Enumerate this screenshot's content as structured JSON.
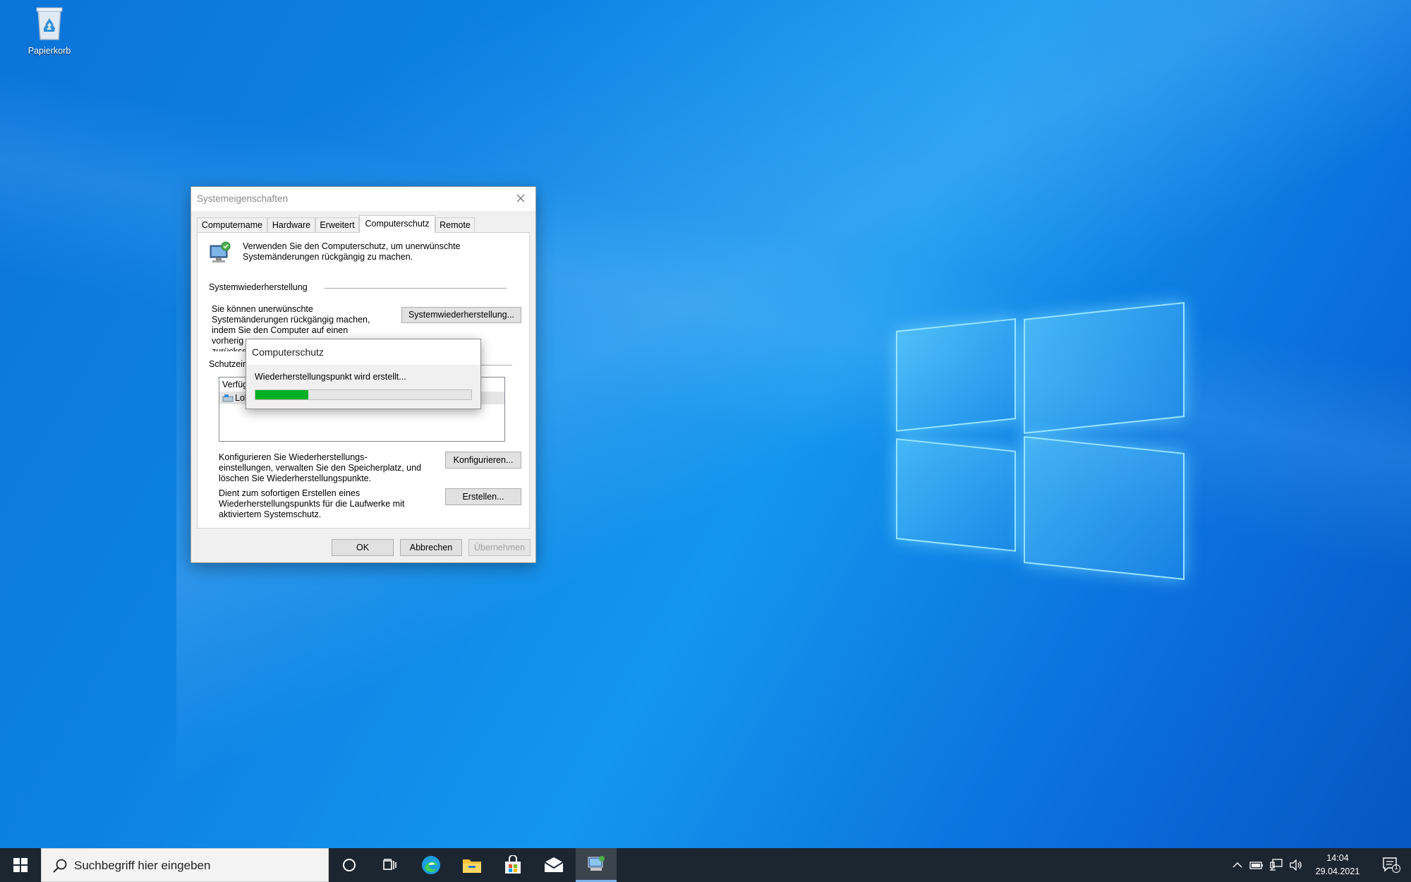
{
  "desktop": {
    "recycle_bin_label": "Papierkorb"
  },
  "dialog": {
    "title": "Systemeigenschaften",
    "tabs": [
      {
        "label": "Computername"
      },
      {
        "label": "Hardware"
      },
      {
        "label": "Erweitert"
      },
      {
        "label": "Computerschutz"
      },
      {
        "label": "Remote"
      }
    ],
    "active_tab": "Computerschutz",
    "intro_line1": "Verwenden Sie den Computerschutz, um unerwünschte",
    "intro_line2": "Systemänderungen rückgängig zu machen.",
    "restore_section_title": "Systemwiederherstellung",
    "restore_text_line1": "Sie können unerwünschte",
    "restore_text_line2": "Systemänderungen rückgängig machen,",
    "restore_text_line3": "indem Sie den Computer auf einen",
    "restore_text_line4": "vorherig",
    "restore_text_line5": "zurückse",
    "restore_button": "Systemwiederherstellung...",
    "protection_section_title": "Schutzein",
    "list_header_partial": "Verfüg",
    "list_item_partial": "Lok",
    "configure_text_line1": "Konfigurieren Sie Wiederherstellungs-",
    "configure_text_line2": "einstellungen, verwalten Sie den Speicherplatz, und",
    "configure_text_line3": "löschen Sie Wiederherstellungspunkte.",
    "configure_button": "Konfigurieren...",
    "create_text_line1": "Dient zum sofortigen Erstellen eines",
    "create_text_line2": "Wiederherstellungspunkts für die Laufwerke mit",
    "create_text_line3": "aktiviertem Systemschutz.",
    "create_button": "Erstellen...",
    "ok_button": "OK",
    "cancel_button": "Abbrechen",
    "apply_button": "Übernehmen"
  },
  "progress_popup": {
    "title": "Computerschutz",
    "message": "Wiederherstellungspunkt wird erstellt...",
    "progress_fraction": 0.245,
    "fill_color": "#06b025"
  },
  "taskbar": {
    "search_placeholder": "Suchbegriff hier eingeben",
    "apps": [
      "start-icon",
      "cortana-icon",
      "task-view-icon",
      "edge-icon",
      "file-explorer-icon",
      "store-icon",
      "mail-icon",
      "system-properties-icon"
    ],
    "time": "14:04",
    "date": "29.04.2021",
    "notification_count": "1"
  }
}
